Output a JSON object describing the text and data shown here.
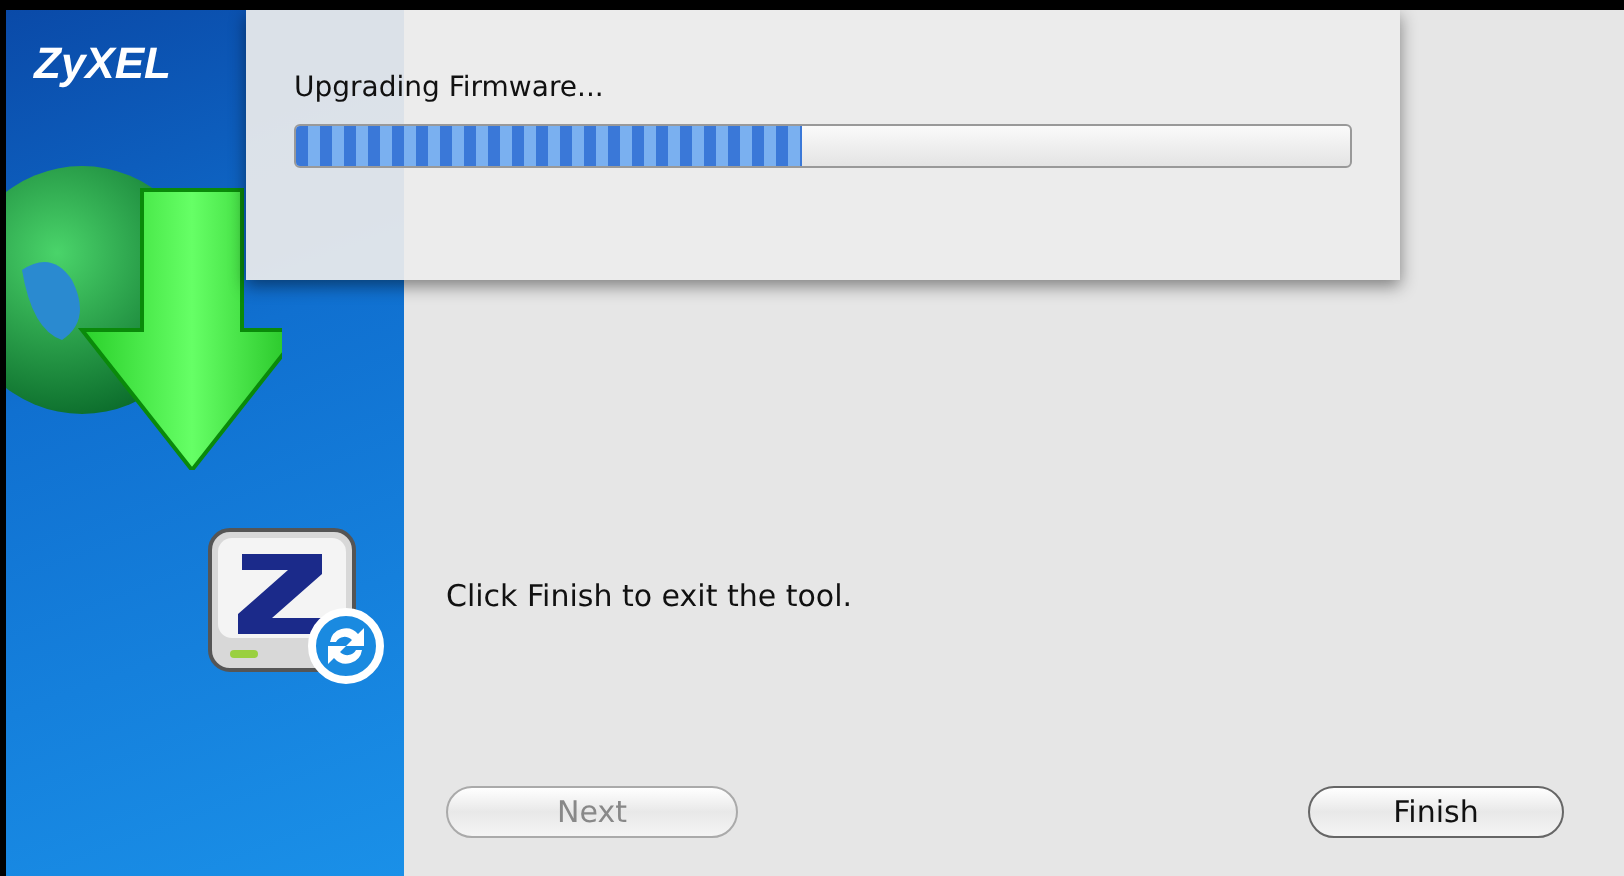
{
  "logo": "ZyXEL",
  "sheet": {
    "title": "Upgrading Firmware...",
    "progress": {
      "level": 0.48
    }
  },
  "message": "Click Finish to exit the tool.",
  "buttons": [
    {
      "label": "Next",
      "disabled": true
    },
    {
      "label": "Finish",
      "disabled": false
    }
  ]
}
